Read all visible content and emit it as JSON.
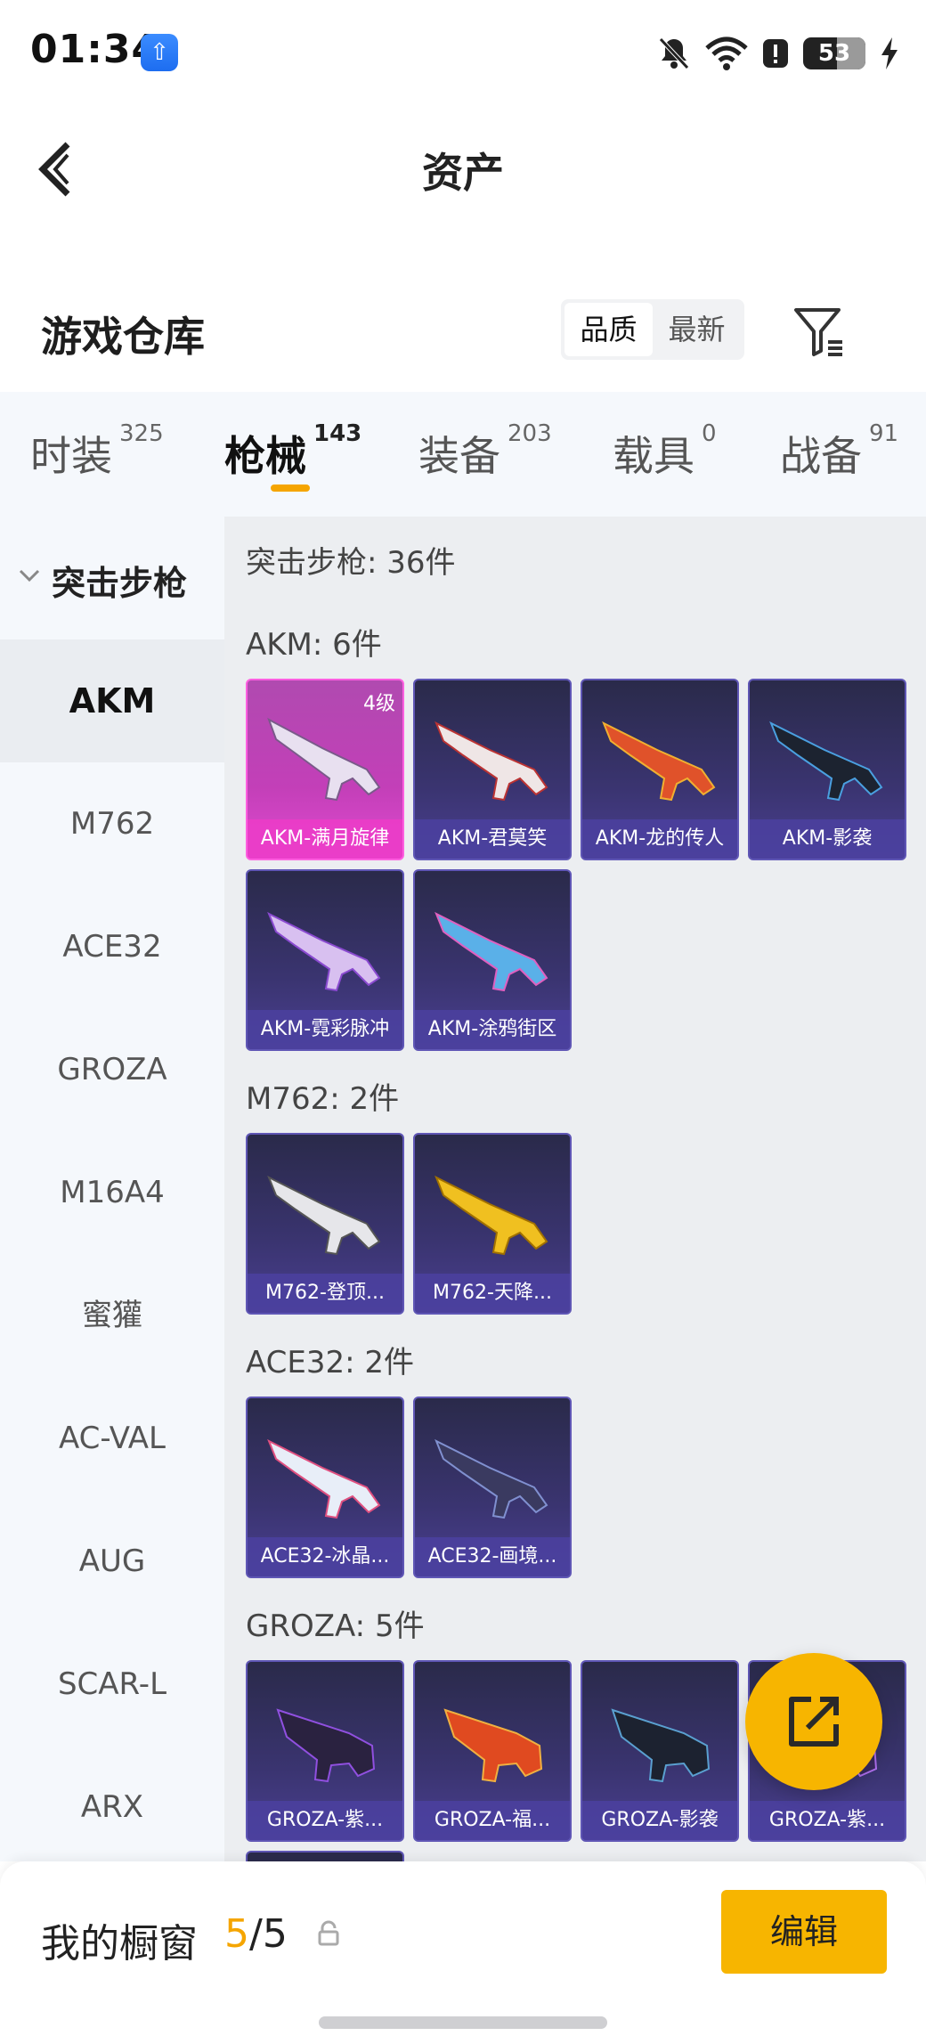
{
  "status_bar": {
    "time": "01:34",
    "battery": "53"
  },
  "header": {
    "title": "资产"
  },
  "warehouse": {
    "title": "游戏仓库",
    "sort_options": [
      "品质",
      "最新"
    ]
  },
  "tabs": [
    {
      "label": "时装",
      "count": "325"
    },
    {
      "label": "枪械",
      "count": "143"
    },
    {
      "label": "装备",
      "count": "203"
    },
    {
      "label": "载具",
      "count": "0"
    },
    {
      "label": "战备",
      "count": "91"
    }
  ],
  "sidebar": {
    "category": "突击步枪",
    "items": [
      "AKM",
      "M762",
      "ACE32",
      "GROZA",
      "M16A4",
      "蜜獾",
      "AC-VAL",
      "AUG",
      "SCAR-L",
      "ARX"
    ]
  },
  "content": {
    "title": "突击步枪: 36件",
    "groups": [
      {
        "title": "AKM: 6件",
        "items": [
          {
            "name": "AKM-满月旋律",
            "level": "4级"
          },
          {
            "name": "AKM-君莫笑"
          },
          {
            "name": "AKM-龙的传人"
          },
          {
            "name": "AKM-影袭"
          },
          {
            "name": "AKM-霓彩脉冲"
          },
          {
            "name": "AKM-涂鸦街区"
          }
        ]
      },
      {
        "title": "M762: 2件",
        "items": [
          {
            "name": "M762-登顶..."
          },
          {
            "name": "M762-天降..."
          }
        ]
      },
      {
        "title": "ACE32: 2件",
        "items": [
          {
            "name": "ACE32-冰晶..."
          },
          {
            "name": "ACE32-画境..."
          }
        ]
      },
      {
        "title": "GROZA: 5件",
        "items": [
          {
            "name": "GROZA-紫..."
          },
          {
            "name": "GROZA-福..."
          },
          {
            "name": "GROZA-影袭"
          },
          {
            "name": "GROZA-紫..."
          }
        ]
      }
    ]
  },
  "showcase": {
    "label": "我的橱窗",
    "current": "5",
    "total": "/5",
    "edit_label": "编辑"
  },
  "colors": {
    "accent": "#f7b500",
    "tab_indicator": "#f5a500",
    "card_purple": "#3a3470",
    "card_pink": "#e04ad0"
  },
  "icons": [
    "back-arrow-icon",
    "filter-icon",
    "chevron-down-icon",
    "share-edit-icon",
    "lock-icon",
    "bell-off-icon",
    "wifi-icon",
    "alert-icon",
    "charging-icon"
  ]
}
